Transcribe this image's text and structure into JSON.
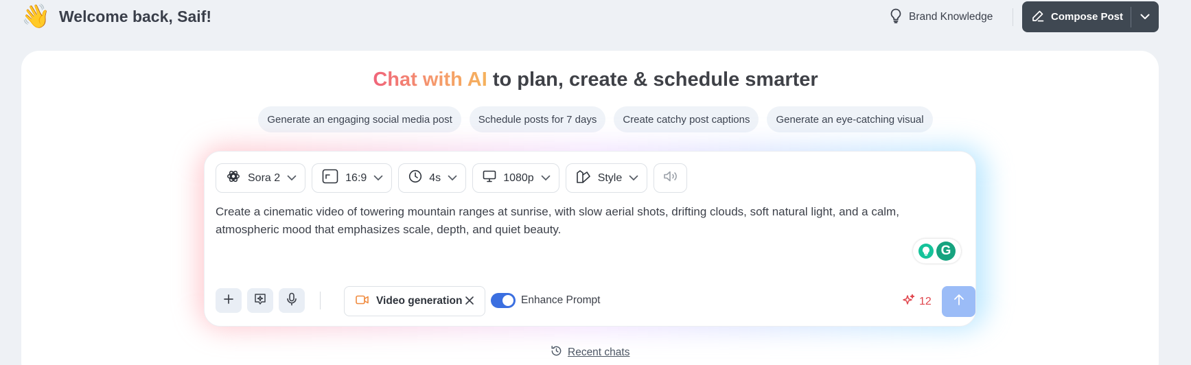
{
  "header": {
    "wave_emoji": "👋",
    "welcome": "Welcome back, Saif!",
    "brand_knowledge": "Brand Knowledge",
    "compose_post": "Compose Post"
  },
  "hero": {
    "highlight": "Chat with AI",
    "rest": " to plan, create & schedule smarter",
    "gradient_colors": [
      "#f0647a",
      "#f5b25c"
    ]
  },
  "suggestions": [
    "Generate an engaging social media post",
    "Schedule posts for 7 days",
    "Create catchy post captions",
    "Generate an eye-catching visual"
  ],
  "composer": {
    "options": {
      "model": "Sora 2",
      "aspect": "16:9",
      "duration": "4s",
      "resolution": "1080p",
      "style": "Style"
    },
    "prompt": "Create a cinematic video of towering mountain ranges at sunrise, with slow aerial shots, drifting clouds, soft natural light, and a calm, atmospheric mood that emphasizes scale, depth, and quiet beauty.",
    "mode_chip": "Video generation",
    "enhance_prompt_label": "Enhance Prompt",
    "enhance_prompt_on": true,
    "credits": "12",
    "accent_color": "#3b6fe0",
    "credits_color": "#e0474e"
  },
  "recent_chats": "Recent chats"
}
